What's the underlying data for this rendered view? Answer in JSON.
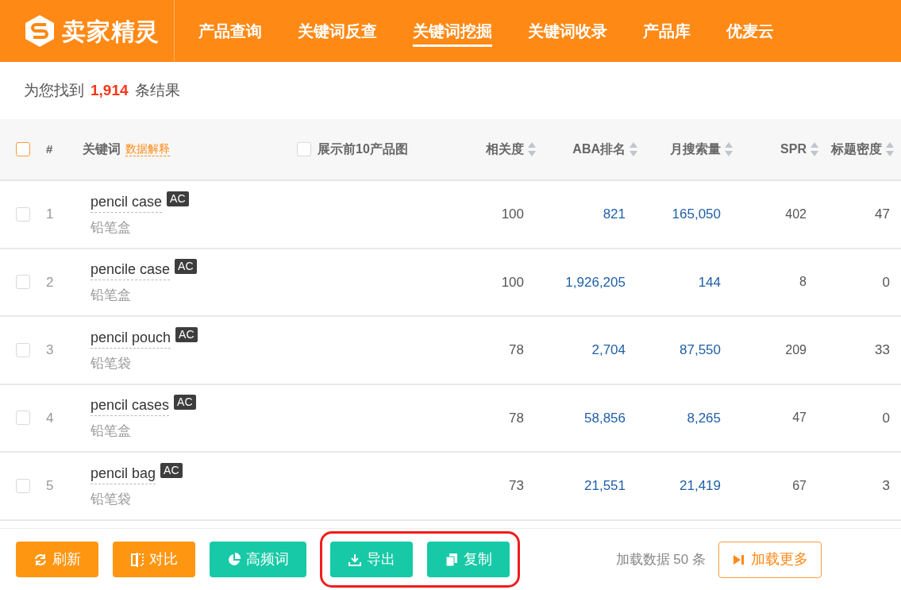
{
  "logo": {
    "text": "卖家精灵"
  },
  "nav": [
    {
      "label": "产品查询",
      "selected": false
    },
    {
      "label": "关键词反查",
      "selected": false
    },
    {
      "label": "关键词挖掘",
      "selected": true
    },
    {
      "label": "关键词收录",
      "selected": false
    },
    {
      "label": "产品库",
      "selected": false
    },
    {
      "label": "优麦云",
      "selected": false
    }
  ],
  "summary": {
    "prefix": "为您找到",
    "count": "1,914",
    "suffix": "条结果"
  },
  "table": {
    "select_all_checked": false,
    "index_header": "#",
    "keyword_header": "关键词",
    "data_help": "数据解释",
    "show_images": {
      "label": "展示前10产品图",
      "checked": false
    },
    "columns": [
      "相关度",
      "ABA排名",
      "月搜索量",
      "SPR",
      "标题密度"
    ],
    "rows": [
      {
        "index": "1",
        "keyword": "pencil case",
        "tag": "AC",
        "translation": "铅笔盒",
        "checked": false,
        "relevance": "100",
        "aba_rank": "821",
        "monthly_searches": "165,050",
        "spr": "402",
        "title_density": "47"
      },
      {
        "index": "2",
        "keyword": "pencile case",
        "tag": "AC",
        "translation": "铅笔盒",
        "checked": false,
        "relevance": "100",
        "aba_rank": "1,926,205",
        "monthly_searches": "144",
        "spr": "8",
        "title_density": "0"
      },
      {
        "index": "3",
        "keyword": "pencil pouch",
        "tag": "AC",
        "translation": "铅笔袋",
        "checked": false,
        "relevance": "78",
        "aba_rank": "2,704",
        "monthly_searches": "87,550",
        "spr": "209",
        "title_density": "33"
      },
      {
        "index": "4",
        "keyword": "pencil cases",
        "tag": "AC",
        "translation": "铅笔盒",
        "checked": false,
        "relevance": "78",
        "aba_rank": "58,856",
        "monthly_searches": "8,265",
        "spr": "47",
        "title_density": "0"
      },
      {
        "index": "5",
        "keyword": "pencil bag",
        "tag": "AC",
        "translation": "铅笔袋",
        "checked": false,
        "relevance": "73",
        "aba_rank": "21,551",
        "monthly_searches": "21,419",
        "spr": "67",
        "title_density": "3"
      }
    ]
  },
  "footer": {
    "buttons": [
      {
        "label": "刷新",
        "kind": "refresh",
        "highlighted": false
      },
      {
        "label": "对比",
        "kind": "compare",
        "highlighted": false
      },
      {
        "label": "高频词",
        "kind": "frequency",
        "highlighted": false
      },
      {
        "label": "导出",
        "kind": "export",
        "highlighted": true
      },
      {
        "label": "复制",
        "kind": "copy",
        "highlighted": true
      }
    ],
    "load_info": "加载数据 50 条",
    "load_more": "加载更多"
  }
}
